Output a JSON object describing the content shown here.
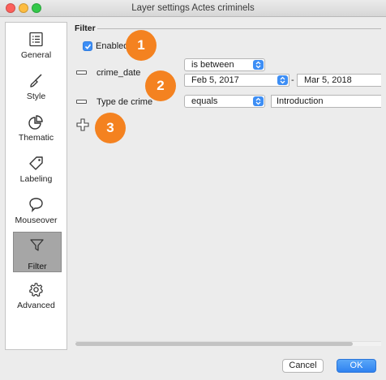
{
  "window": {
    "title": "Layer settings Actes criminels"
  },
  "sidebar": {
    "items": [
      {
        "label": "General",
        "icon": "list-icon"
      },
      {
        "label": "Style",
        "icon": "brush-icon"
      },
      {
        "label": "Thematic",
        "icon": "pie-chart-icon"
      },
      {
        "label": "Labeling",
        "icon": "tag-icon"
      },
      {
        "label": "Mouseover",
        "icon": "speech-bubble-icon"
      },
      {
        "label": "Filter",
        "icon": "funnel-icon",
        "active": true
      },
      {
        "label": "Advanced",
        "icon": "gear-icon"
      }
    ]
  },
  "filter": {
    "heading": "Filter",
    "enabled_label": "Enabled",
    "enabled": true,
    "rows": [
      {
        "field": "crime_date",
        "operator": "is between",
        "value_from": "Feb 5, 2017",
        "separator": "-",
        "value_to": "Mar 5, 2018"
      },
      {
        "field": "Type de crime",
        "operator": "equals",
        "value": "Introduction"
      }
    ]
  },
  "annotations": [
    "1",
    "2",
    "3"
  ],
  "buttons": {
    "cancel": "Cancel",
    "ok": "OK"
  },
  "colors": {
    "accent": "#3d8ef5",
    "badge": "#f48220",
    "active_sidebar": "#a6a6a6"
  }
}
